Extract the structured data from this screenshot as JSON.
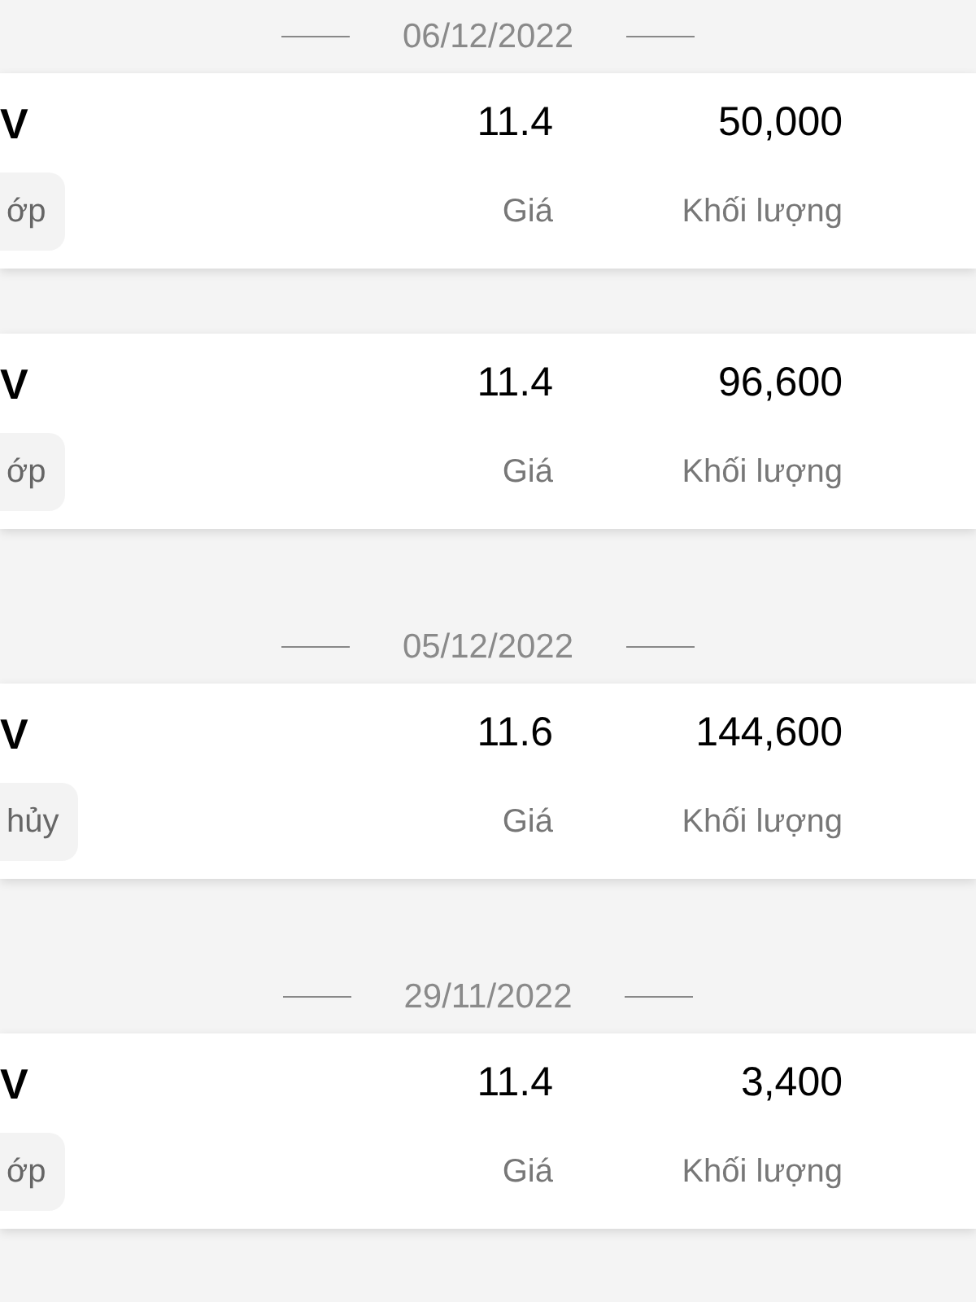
{
  "groups": [
    {
      "date": "06/12/2022",
      "orders": [
        {
          "code": "V",
          "price": "11.4",
          "volume": "50,000",
          "status": "ớp",
          "price_label": "Giá",
          "volume_label": "Khối lượng"
        },
        {
          "code": "V",
          "price": "11.4",
          "volume": "96,600",
          "status": "ớp",
          "price_label": "Giá",
          "volume_label": "Khối lượng"
        }
      ]
    },
    {
      "date": "05/12/2022",
      "orders": [
        {
          "code": "V",
          "price": "11.6",
          "volume": "144,600",
          "status": "hủy",
          "price_label": "Giá",
          "volume_label": "Khối lượng"
        }
      ]
    },
    {
      "date": "29/11/2022",
      "orders": [
        {
          "code": "V",
          "price": "11.4",
          "volume": "3,400",
          "status": "ớp",
          "price_label": "Giá",
          "volume_label": "Khối lượng"
        }
      ]
    }
  ]
}
